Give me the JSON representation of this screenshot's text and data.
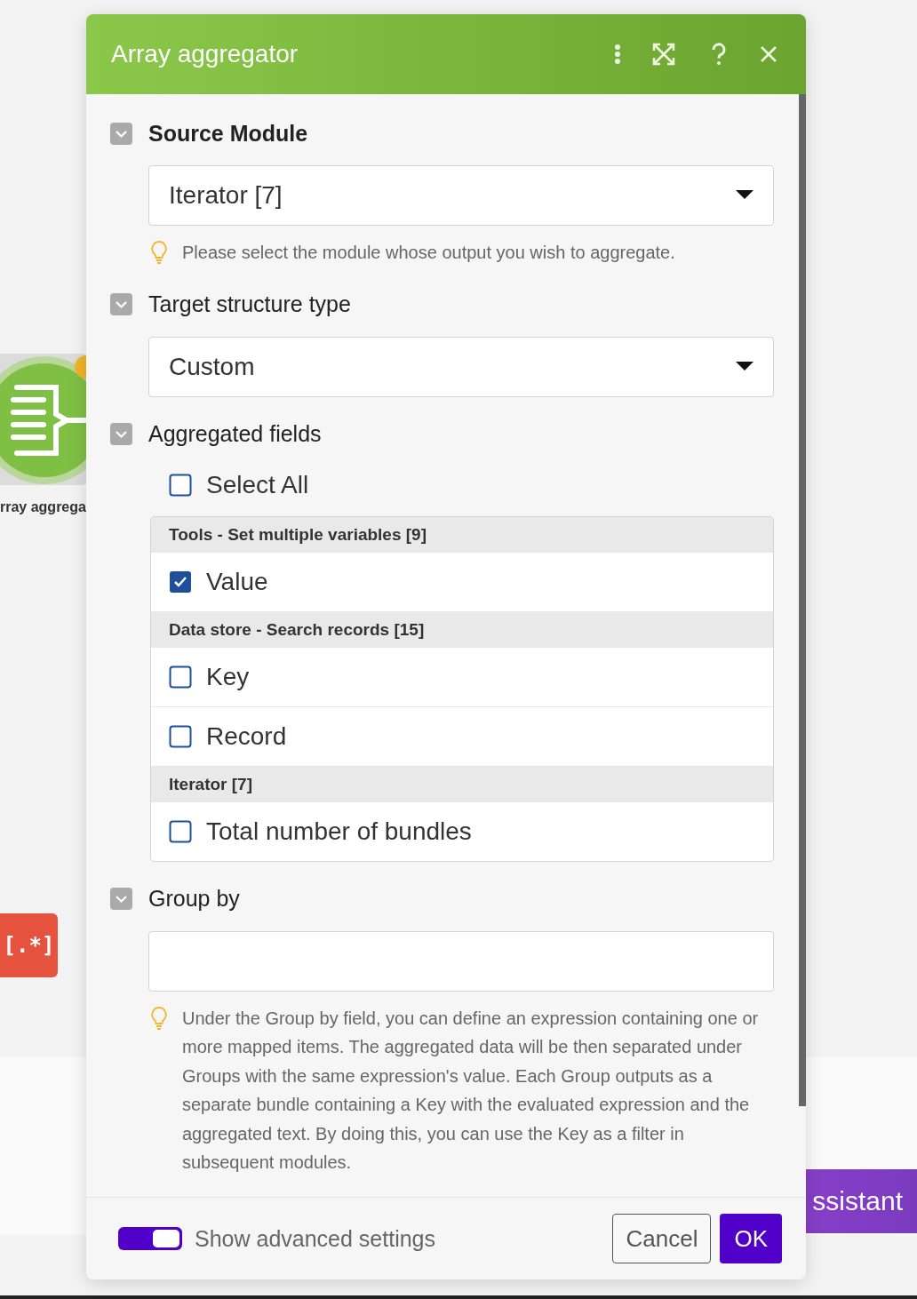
{
  "canvas": {
    "node_label": "rray aggrega",
    "tool_button": "[.*]",
    "assistant_button": "ssistant"
  },
  "dialog": {
    "title": "Array aggregator",
    "sections": [
      {
        "kind": "select",
        "label": "Source Module",
        "required": true,
        "expanded": true,
        "value": "Iterator [7]",
        "hint": "Please select the module whose output you wish to aggregate."
      },
      {
        "kind": "select",
        "label": "Target structure type",
        "required": false,
        "expanded": true,
        "value": "Custom"
      },
      {
        "kind": "checklist",
        "label": "Aggregated fields",
        "required": false,
        "expanded": true,
        "select_all": {
          "label": "Select All",
          "checked": false
        },
        "groups": [
          {
            "title": "Tools - Set multiple variables [9]",
            "items": [
              {
                "label": "Value",
                "checked": true
              }
            ]
          },
          {
            "title": "Data store - Search records [15]",
            "items": [
              {
                "label": "Key",
                "checked": false
              },
              {
                "label": "Record",
                "checked": false
              }
            ]
          },
          {
            "title": "Iterator [7]",
            "items": [
              {
                "label": "Total number of bundles",
                "checked": false
              }
            ]
          }
        ]
      },
      {
        "kind": "text",
        "label": "Group by",
        "required": false,
        "expanded": true,
        "hint": "Under the Group by field, you can define an expression containing one or more mapped items. The aggregated data will be then separated under Groups with the same expression's value. Each Group outputs as a separate bundle containing a Key with the evaluated expression and the aggregated text. By doing this, you can use the Key as a filter in subsequent modules."
      }
    ],
    "footer": {
      "advanced": {
        "label": "Show advanced settings",
        "on": true
      },
      "cancel": "Cancel",
      "ok": "OK"
    }
  }
}
